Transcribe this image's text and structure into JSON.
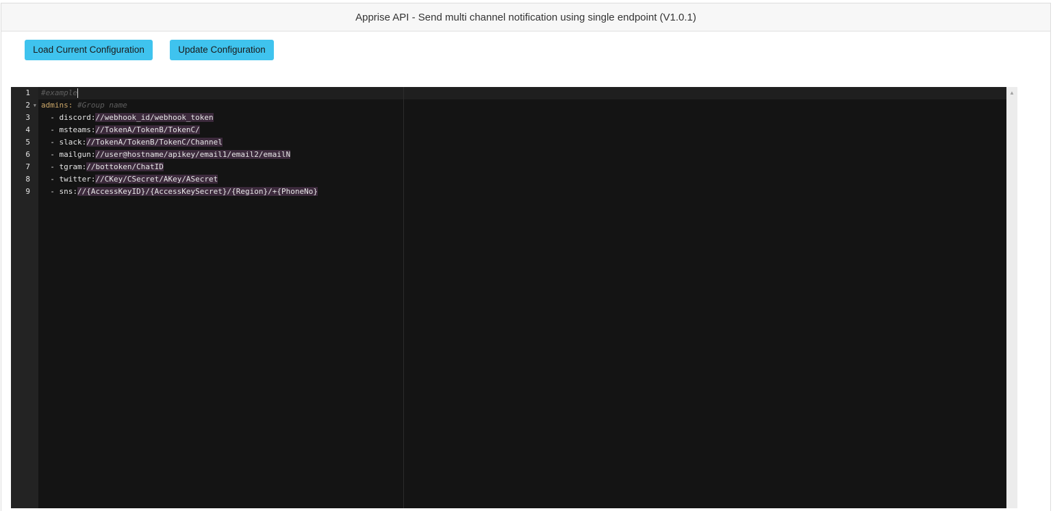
{
  "header": {
    "title": "Apprise API - Send multi channel notification using single endpoint (V1.0.1)"
  },
  "toolbar": {
    "load_label": "Load Current Configuration",
    "update_label": "Update Configuration"
  },
  "editor": {
    "line_numbers": [
      "1",
      "2",
      "3",
      "4",
      "5",
      "6",
      "7",
      "8",
      "9"
    ],
    "lines": {
      "l1": {
        "comment": "#example"
      },
      "l2": {
        "key": "admins:",
        "comment": "#Group name"
      },
      "l3": {
        "prefix": "  - discord:",
        "value": "//webhook_id/webhook_token"
      },
      "l4": {
        "prefix": "  - msteams:",
        "value": "//TokenA/TokenB/TokenC/"
      },
      "l5": {
        "prefix": "  - slack:",
        "value": "//TokenA/TokenB/TokenC/Channel"
      },
      "l6": {
        "prefix": "  - mailgun:",
        "value": "//user@hostname/apikey/email1/email2/emailN"
      },
      "l7": {
        "prefix": "  - tgram:",
        "value": "//bottoken/ChatID"
      },
      "l8": {
        "prefix": "  - twitter:",
        "value": "//CKey/CSecret/AKey/ASecret"
      },
      "l9": {
        "prefix": "  - sns:",
        "value": "//{AccessKeyID}/{AccessKeySecret}/{Region}/+{PhoneNo}"
      }
    },
    "colors": {
      "background": "#141414",
      "gutter": "#232323",
      "comment": "#5f5f5f",
      "key": "#cda869",
      "string_highlight": "#3c2a3c"
    }
  },
  "button_color": "#3fc3ee"
}
